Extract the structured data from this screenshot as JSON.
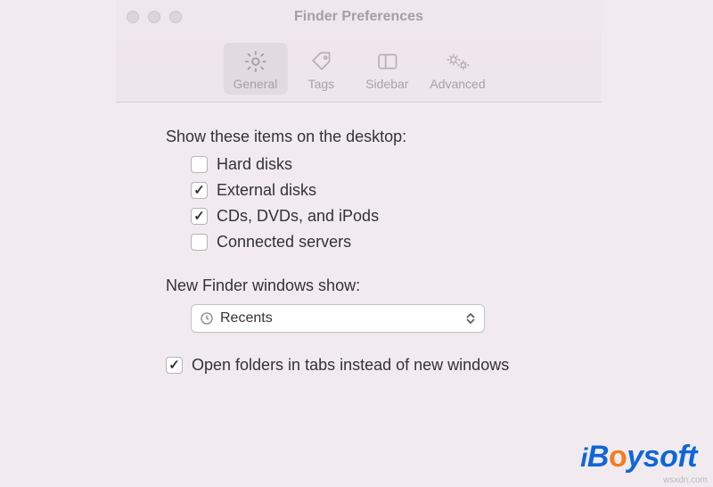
{
  "window": {
    "title": "Finder Preferences"
  },
  "tabs": {
    "general": "General",
    "tags": "Tags",
    "sidebar": "Sidebar",
    "advanced": "Advanced",
    "active": "general"
  },
  "desktopSection": {
    "label": "Show these items on the desktop:",
    "items": [
      {
        "label": "Hard disks",
        "checked": false
      },
      {
        "label": "External disks",
        "checked": true
      },
      {
        "label": "CDs, DVDs, and iPods",
        "checked": true
      },
      {
        "label": "Connected servers",
        "checked": false
      }
    ]
  },
  "newWindowSection": {
    "label": "New Finder windows show:",
    "selected": "Recents"
  },
  "tabsOption": {
    "label": "Open folders in tabs instead of new windows",
    "checked": true
  },
  "watermark": {
    "text": "iBoysoft",
    "srcurl": "wsxdn.com"
  }
}
